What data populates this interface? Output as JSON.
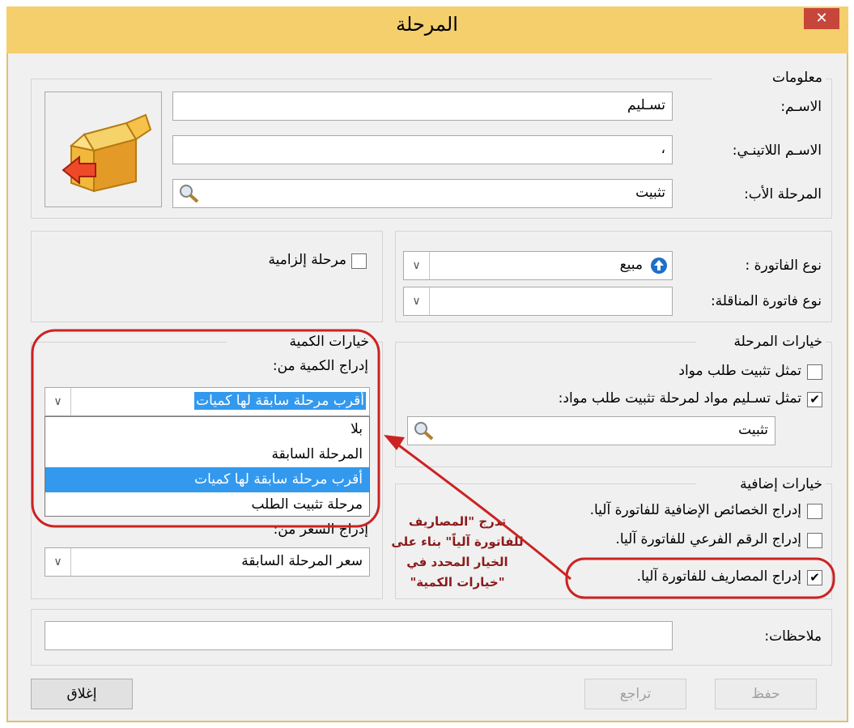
{
  "window": {
    "title": "المرحلة",
    "close_glyph": "✕"
  },
  "info": {
    "group_title": "معلومات",
    "name_label": "الاسـم:",
    "name_value": "تسـليم",
    "latin_label": "الاسـم اللاتينـي:",
    "latin_value": "،",
    "parent_label": "المرحلة الأب:",
    "parent_value": "تثبيت"
  },
  "mandatory": {
    "label": "مرحلة إلزامية",
    "checked": false
  },
  "invoice": {
    "type_label": "نوع الفاتورة :",
    "type_value": "مبيع",
    "transfer_label": "نوع فاتورة المناقلة:",
    "transfer_value": ""
  },
  "stage_options": {
    "group_title": "خيارات المرحلة",
    "opt1_label": "تمثل تثبيت طلب مواد",
    "opt1_checked": false,
    "opt2_label": "تمثل تسـليم مواد لمرحلة تثبيت طلب مواد:",
    "opt2_checked": true,
    "stage_value": "تثبيت"
  },
  "quantity_options": {
    "group_title": "خيارات الكمية",
    "insert_label": "إدراج الكمية من:",
    "selected": "أقرب مرحلة سابقة لها كميات",
    "options": [
      "بلا",
      "المرحلة السابقة",
      "أقرب مرحلة سابقة لها كميات",
      "مرحلة تثبيت الطلب"
    ],
    "selected_index": 2
  },
  "price": {
    "insert_label": "إدراج السعر من:",
    "value": "سعر المرحلة السابقة"
  },
  "extra_options": {
    "group_title": "خيارات إضافية",
    "opt1_label": "إدراج الخصائص الإضافية للفاتورة آليا.",
    "opt1_checked": false,
    "opt2_label": "إدراج الرقم الفرعي للفاتورة آليا.",
    "opt2_checked": false,
    "opt3_label": "إدراج المصاريف للفاتورة آليا.",
    "opt3_checked": true
  },
  "annotation": {
    "line1": "تدرج \"المصاريف",
    "line2": "للفاتورة آلياً\" بناء على",
    "line3": "الخيار المحدد في",
    "line4": "\"خيارات الكمية\""
  },
  "notes": {
    "label": "ملاحظات:",
    "value": ""
  },
  "buttons": {
    "save": "حفظ",
    "undo": "تراجع",
    "close": "إغلاق"
  },
  "icons": {
    "box": "box-with-arrow-icon",
    "search": "magnifier-icon",
    "dropdown": "chevron-down-icon",
    "invoice_type": "up-arrow-circle-icon",
    "check": "✔",
    "dropdown_glyph": "∨"
  },
  "colors": {
    "title_bar": "#f5cf6c",
    "selection": "#3399ee",
    "annotation": "#cc2222",
    "close": "#c7463a"
  }
}
